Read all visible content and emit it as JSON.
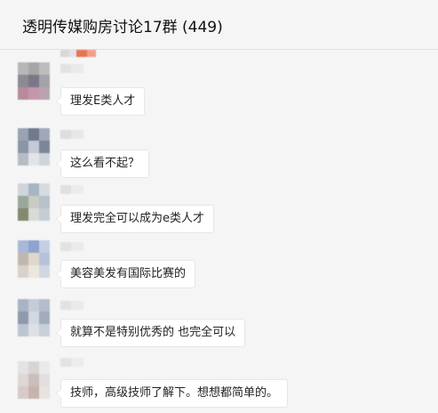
{
  "header": {
    "title": "透明传媒购房讨论17群 (449)"
  },
  "colors": {
    "background": "#f5f5f5",
    "bubble": "#ffffff",
    "bubble_border": "#e6e6e6"
  },
  "messages": [
    {
      "text": "理发E类人才"
    },
    {
      "text": "这么看不起？"
    },
    {
      "text": "理发完全可以成为e类人才"
    },
    {
      "text": "美容美发有国际比赛的"
    },
    {
      "text": "就算不是特别优秀的 也完全可以"
    },
    {
      "text": "技师，高级技师了解下。想想都简单的。"
    }
  ]
}
